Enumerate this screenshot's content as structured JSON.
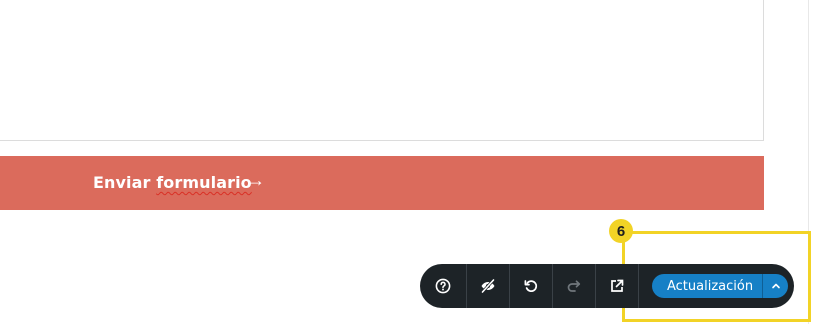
{
  "form": {
    "submit_label_start": "Enviar ",
    "submit_label_word": "formulario",
    "submit_arrow": "→"
  },
  "tutorial": {
    "step_number": "6",
    "highlight_color": "#f2d326"
  },
  "toolbar": {
    "buttons": [
      {
        "icon": "help-icon"
      },
      {
        "icon": "hide-icon"
      },
      {
        "icon": "undo-icon"
      },
      {
        "icon": "redo-icon"
      },
      {
        "icon": "external-link-icon"
      }
    ],
    "update_label": "Actualización",
    "update_toggle_icon": "chevron-up-icon",
    "accent_color": "#1680c6",
    "background_color": "#1d2327"
  },
  "colors": {
    "submit_bar": "#db6b5c"
  }
}
